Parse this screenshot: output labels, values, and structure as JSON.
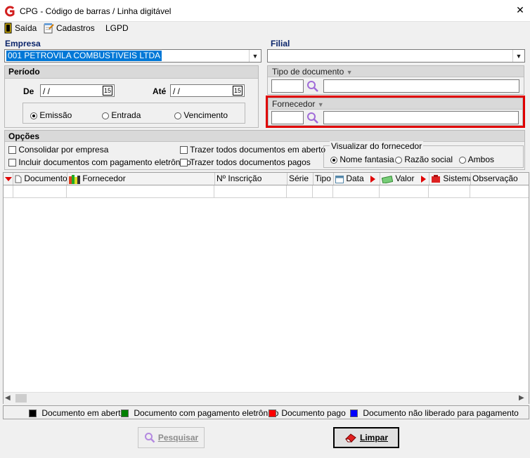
{
  "window": {
    "title": "CPG - Código de barras / Linha digitável"
  },
  "toolbar": {
    "exit_label": "Saída",
    "registers_label": "Cadastros",
    "lgpd_label": "LGPD"
  },
  "empresa": {
    "label": "Empresa",
    "value": "001 PETROVILA COMBUSTIVEIS LTDA"
  },
  "filial": {
    "label": "Filial",
    "value": ""
  },
  "periodo": {
    "title": "Período",
    "de_label": "De",
    "de_value": " / /",
    "ate_label": "Até",
    "ate_value": " / /",
    "calendar_label": "15",
    "radios": [
      "Emissão",
      "Entrada",
      "Vencimento"
    ],
    "selected": "Emissão"
  },
  "tipo_documento": {
    "label": "Tipo de documento",
    "code": "",
    "description": ""
  },
  "fornecedor": {
    "label": "Fornecedor",
    "code": "",
    "description": ""
  },
  "opcoes": {
    "title": "Opções",
    "checks": [
      "Consolidar por empresa",
      "Incluir documentos com pagamento eletrônico",
      "Trazer todos documentos em aberto",
      "Trazer todos documentos pagos"
    ],
    "visualizar": {
      "title": "Visualizar do fornecedor",
      "options": [
        "Nome fantasia",
        "Razão social",
        "Ambos"
      ],
      "selected": "Nome fantasia"
    }
  },
  "grid": {
    "columns": [
      "Documento",
      "Fornecedor",
      "Nº Inscrição",
      "Série",
      "Tipo",
      "Data",
      "Valor",
      "Sistema",
      "Observação"
    ]
  },
  "legend": [
    {
      "label": "Documento em aberto",
      "color": "#000000"
    },
    {
      "label": "Documento com pagamento eletrônico",
      "color": "#008000"
    },
    {
      "label": "Documento pago",
      "color": "#ff0000"
    },
    {
      "label": "Documento não liberado para pagamento",
      "color": "#0000ff"
    }
  ],
  "buttons": {
    "search_label": "Pesquisar",
    "clear_label": "Limpar"
  },
  "colors": {
    "accent": "#0078d7",
    "highlight_border": "#e00000",
    "label_blue": "#0a246a"
  }
}
